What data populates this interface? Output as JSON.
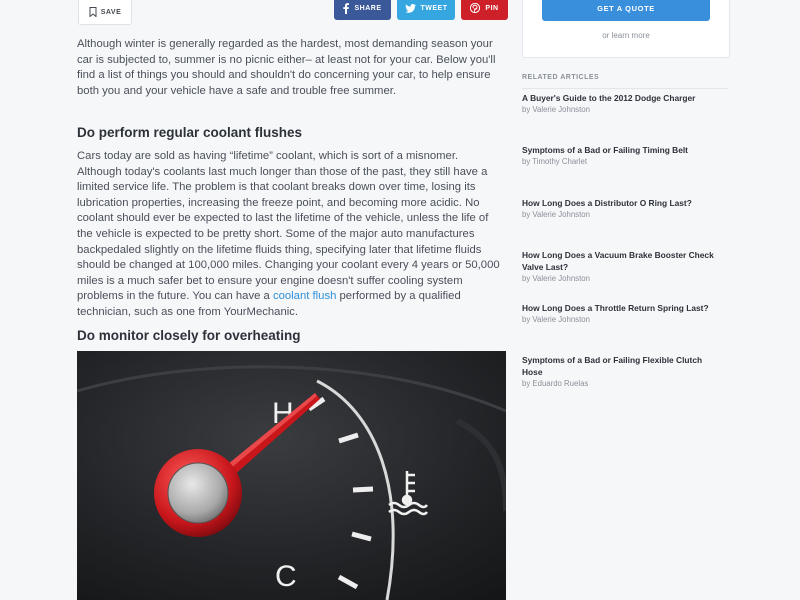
{
  "actions": {
    "save_label": "SAVE",
    "share_facebook": "SHARE",
    "share_twitter": "TWEET",
    "share_pinterest": "PIN"
  },
  "article": {
    "intro": "Although winter is generally regarded as the hardest, most demanding season your car is subjected to, summer is no picnic either– at least not for your car. Below you'll find a list of things you should and shouldn't do concerning your car, to help ensure both you and your vehicle have a safe and trouble free summer.",
    "section1": {
      "heading": "Do perform regular coolant flushes",
      "body_before_link": "Cars today are sold as having “lifetime” coolant, which is sort of a misnomer. Although today's coolants last much longer than those of the past, they still have a limited service life. The problem is that coolant breaks down over time, losing its lubrication properties, increasing the freeze point, and becoming more acidic. No coolant should ever be expected to last the lifetime of the vehicle, unless the life of the vehicle is expected to be pretty short. Some of the major auto manufactures backpedaled slightly on the lifetime fluids thing, specifying later that lifetime fluids should be changed at 100,000 miles. Changing your coolant every 4 years or 50,000 miles is a much safer bet to ensure your engine doesn't suffer cooling system problems in the future. You can have a ",
      "link_text": "coolant flush",
      "body_after_link": " performed by a qualified technician, such as one from YourMechanic."
    },
    "section2": {
      "heading": "Do monitor closely for overheating",
      "gauge_hot_label": "H",
      "gauge_cold_label": "C"
    }
  },
  "sidebar": {
    "quote_button": "GET A QUOTE",
    "learn_more": "or learn more",
    "related_title": "RELATED ARTICLES",
    "related": [
      {
        "title": "A Buyer's Guide to the 2012 Dodge Charger",
        "author": "by Valerie Johnston"
      },
      {
        "title": "Symptoms of a Bad or Failing Timing Belt",
        "author": "by Timothy Charlet"
      },
      {
        "title": "How Long Does a Distributor O Ring Last?",
        "author": "by Valerie Johnston"
      },
      {
        "title": "How Long Does a Vacuum Brake Booster Check Valve Last?",
        "author": "by Valerie Johnston"
      },
      {
        "title": "How Long Does a Throttle Return Spring Last?",
        "author": "by Valerie Johnston"
      },
      {
        "title": "Symptoms of a Bad or Failing Flexible Clutch Hose",
        "author": "by Eduardo Ruelas"
      }
    ]
  },
  "colors": {
    "facebook": "#3b5998",
    "twitter": "#35a6e0",
    "pinterest": "#cd2029",
    "accent": "#3a8fdc",
    "link": "#2f8fd8"
  },
  "icons": [
    "bookmark-icon",
    "facebook-icon",
    "twitter-icon",
    "pinterest-icon",
    "coolant-temperature-icon"
  ]
}
